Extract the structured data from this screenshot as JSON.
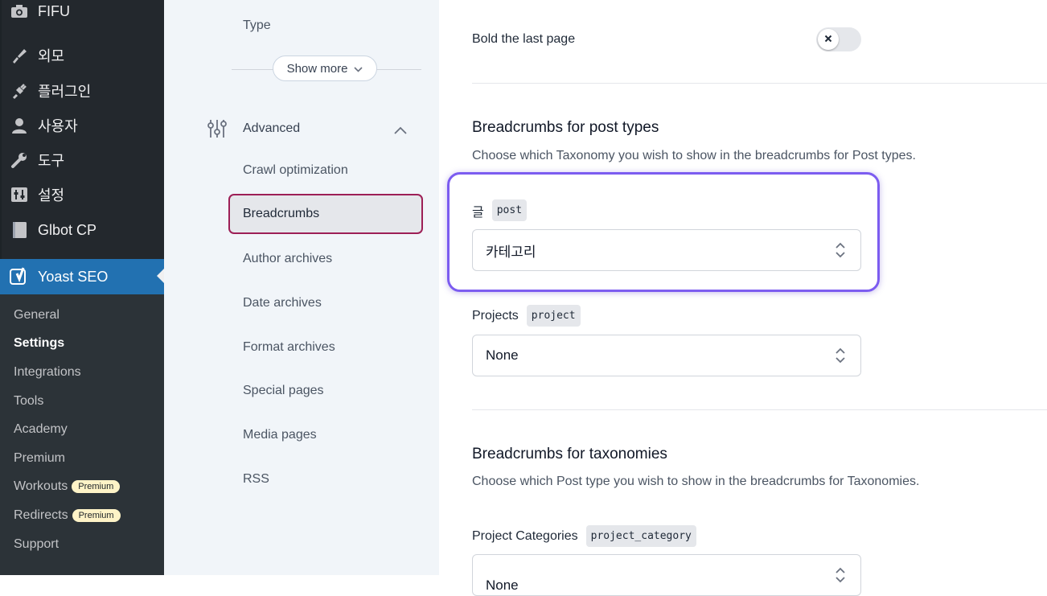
{
  "wp_menu": {
    "items": [
      {
        "label": "FIFU",
        "icon": "camera-icon"
      },
      {
        "label": "외모",
        "icon": "paintbrush-icon"
      },
      {
        "label": "플러그인",
        "icon": "plugin-icon"
      },
      {
        "label": "사용자",
        "icon": "user-icon"
      },
      {
        "label": "도구",
        "icon": "wrench-icon"
      },
      {
        "label": "설정",
        "icon": "settings-sliders-icon"
      },
      {
        "label": "Glbot CP",
        "icon": "book-icon"
      }
    ],
    "yoast": {
      "label": "Yoast SEO",
      "icon": "yoast-icon"
    },
    "submenu": [
      {
        "label": "General"
      },
      {
        "label": "Settings",
        "current": true
      },
      {
        "label": "Integrations"
      },
      {
        "label": "Tools"
      },
      {
        "label": "Academy"
      },
      {
        "label": "Premium"
      },
      {
        "label": "Workouts",
        "badge": "Premium"
      },
      {
        "label": "Redirects",
        "badge": "Premium"
      },
      {
        "label": "Support"
      }
    ]
  },
  "settings_nav": {
    "type_label": "Type",
    "show_more": "Show more",
    "advanced_label": "Advanced",
    "advanced_links": [
      "Crawl optimization",
      "Breadcrumbs",
      "Author archives",
      "Date archives",
      "Format archives",
      "Special pages",
      "Media pages",
      "RSS"
    ],
    "active": "Breadcrumbs"
  },
  "main": {
    "bold_last_page": {
      "label": "Bold the last page",
      "enabled": false
    },
    "post_types_section": {
      "title": "Breadcrumbs for post types",
      "description": "Choose which Taxonomy you wish to show in the breadcrumbs for Post types."
    },
    "post_field": {
      "label": "글",
      "code": "post",
      "value": "카테고리"
    },
    "projects_field": {
      "label": "Projects",
      "code": "project",
      "value": "None"
    },
    "taxonomies_section": {
      "title": "Breadcrumbs for taxonomies",
      "description": "Choose which Post type you wish to show in the breadcrumbs for Taxonomies."
    },
    "project_categories_field": {
      "label": "Project Categories",
      "code": "project_category",
      "value": "None"
    }
  },
  "colors": {
    "wp_sidebar": "#23282d",
    "wp_active": "#2271b1",
    "yoast_primary": "#9d1f56",
    "highlight": "#7c5cf0"
  }
}
